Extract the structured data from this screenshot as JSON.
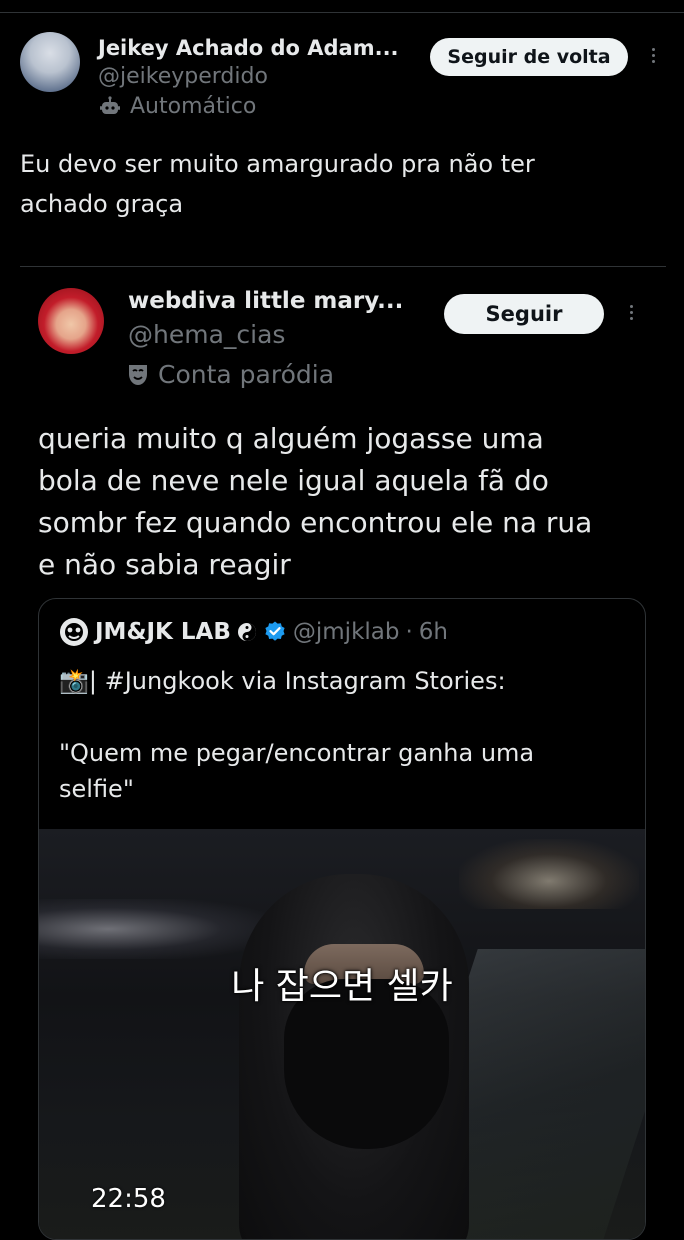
{
  "tweet": {
    "author": {
      "display_name": "Jeikey Achado do Adam...",
      "handle": "@jeikeyperdido",
      "label_icon": "robot-icon",
      "label": "Automático"
    },
    "follow_button": "Seguir de volta",
    "text": "Eu devo ser muito amargurado pra não ter\nachado graça"
  },
  "quoted_tweet": {
    "author": {
      "display_name": "webdiva little mary...",
      "handle": "@hema_cias",
      "label_icon": "theater-mask-icon",
      "label": "Conta paródia"
    },
    "follow_button": "Seguir",
    "text": "queria muito q alguém jogasse uma\nbola de neve nele igual aquela fã do\nsombr fez quando encontrou ele na rua\ne não sabia reagir"
  },
  "nested_quote": {
    "author": {
      "display_name": "JM&JK LAB",
      "handle": "@jmjklab",
      "separator": "·",
      "time": "6h",
      "verified": true
    },
    "text_line1": "📸| #Jungkook via Instagram Stories:",
    "text_line2": "\"Quem me pegar/encontrar ganha uma\nselfie\"",
    "media": {
      "caption": "나 잡으면 셀카",
      "timestamp": "22:58"
    }
  },
  "colors": {
    "background": "#000000",
    "text": "#e7e9ea",
    "secondary_text": "#71767b",
    "divider": "#2f3336",
    "button_bg": "#eff3f4",
    "button_text": "#0f1419",
    "verified": "#1d9bf0"
  }
}
